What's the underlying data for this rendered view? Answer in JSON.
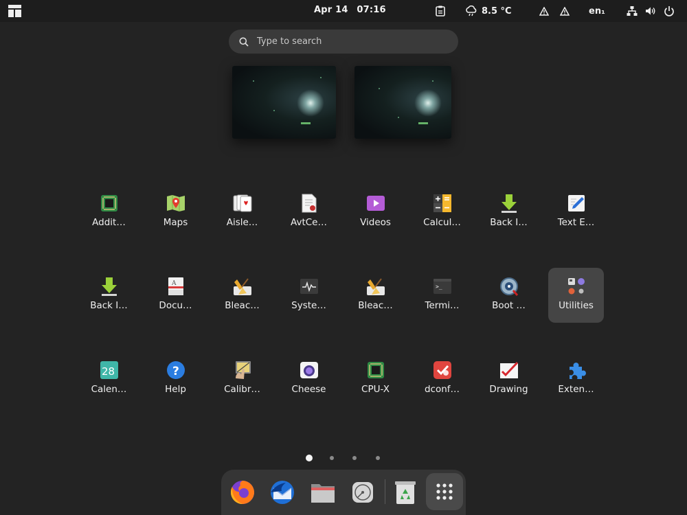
{
  "topbar": {
    "activities_icon": "workspace-layout-icon",
    "date": "Apr 14",
    "time": "07:16",
    "weather": "8.5 °C",
    "language": "en₁"
  },
  "search": {
    "placeholder": "Type to search"
  },
  "apps": [
    {
      "label": "Addit…",
      "icon": "chip-icon"
    },
    {
      "label": "Maps",
      "icon": "map-icon"
    },
    {
      "label": "Aisle…",
      "icon": "cards-icon"
    },
    {
      "label": "AvtCe…",
      "icon": "certificate-icon"
    },
    {
      "label": "Videos",
      "icon": "video-icon"
    },
    {
      "label": "Calcul…",
      "icon": "calculator-icon"
    },
    {
      "label": "Back I…",
      "icon": "download-icon"
    },
    {
      "label": "Text E…",
      "icon": "text-editor-icon"
    },
    {
      "label": "Back I…",
      "icon": "download-icon"
    },
    {
      "label": "Docu…",
      "icon": "document-viewer-icon"
    },
    {
      "label": "Bleac…",
      "icon": "broom-icon"
    },
    {
      "label": "Syste…",
      "icon": "system-monitor-icon"
    },
    {
      "label": "Bleac…",
      "icon": "broom-icon"
    },
    {
      "label": "Termi…",
      "icon": "terminal-icon"
    },
    {
      "label": "Boot …",
      "icon": "boot-repair-icon"
    },
    {
      "label": "Utilities",
      "icon": "folder-grid-icon"
    },
    {
      "label": "Calen…",
      "icon": "calendar-icon"
    },
    {
      "label": "Help",
      "icon": "help-icon"
    },
    {
      "label": "Calibr…",
      "icon": "calibrate-icon"
    },
    {
      "label": "Cheese",
      "icon": "camera-icon"
    },
    {
      "label": "CPU-X",
      "icon": "chip-icon"
    },
    {
      "label": "dconf…",
      "icon": "dconf-icon"
    },
    {
      "label": "Drawing",
      "icon": "drawing-icon"
    },
    {
      "label": "Exten…",
      "icon": "puzzle-icon"
    }
  ],
  "calendar_day": "28",
  "pager": {
    "pages": 4,
    "active": 0
  },
  "dock": [
    "firefox-icon",
    "thunderbird-icon",
    "files-icon",
    "disk-icon",
    "trash-icon",
    "app-grid-icon"
  ],
  "colors": {
    "background": "#232323",
    "topbar": "#1d1d1d",
    "dock": "#353535",
    "hover": "#454545"
  }
}
